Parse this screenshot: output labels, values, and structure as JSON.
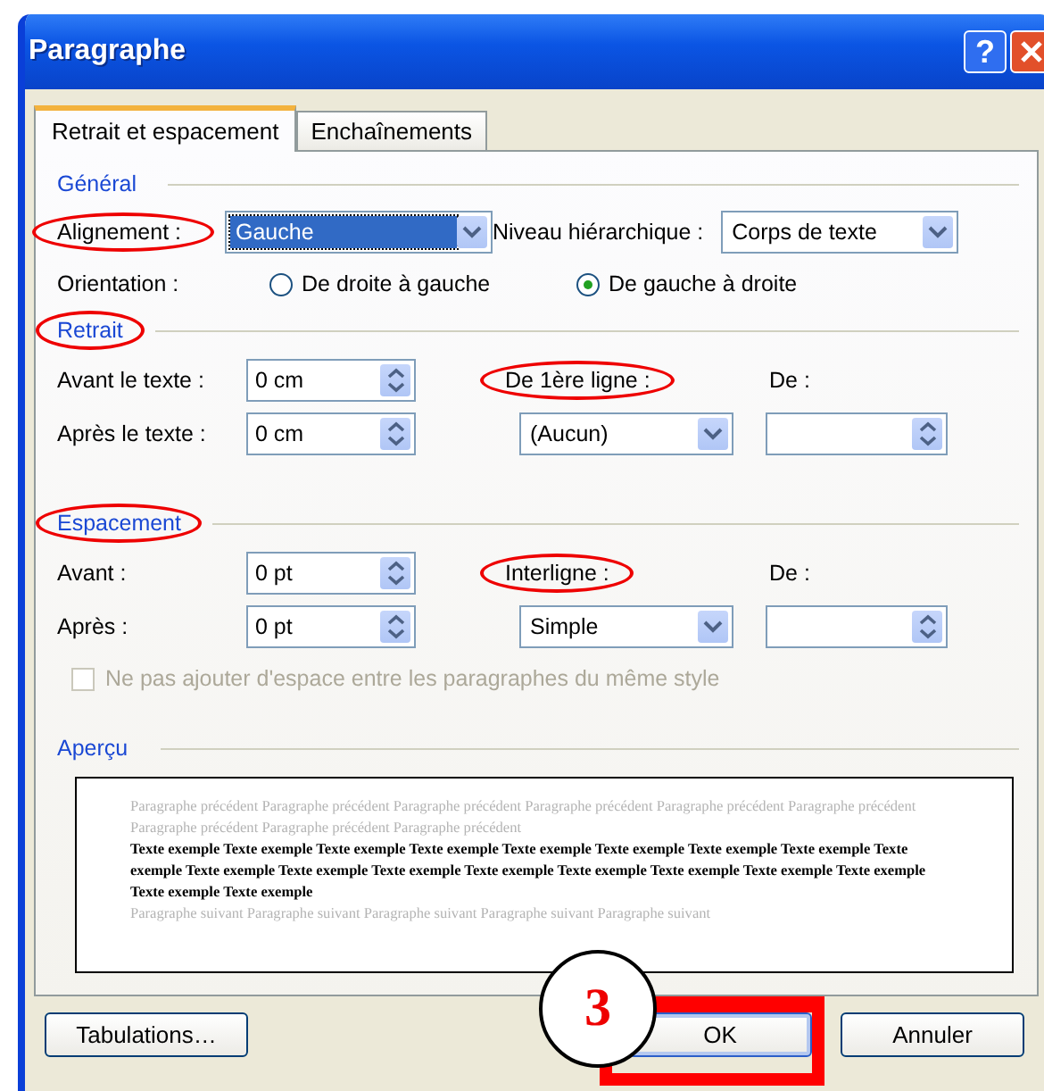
{
  "window": {
    "title": "Paragraphe",
    "help_button": "?"
  },
  "tabs": [
    {
      "label": "Retrait et espacement",
      "selected": true
    },
    {
      "label": "Enchaînements",
      "selected": false
    }
  ],
  "general": {
    "title": {
      "text": "Général",
      "circled": false
    },
    "alignment": {
      "label": {
        "text": "Alignement :",
        "circled": true
      },
      "value": "Gauche",
      "focused": true
    },
    "outline_level": {
      "label": {
        "text": "Niveau hiérarchique :",
        "circled": false
      },
      "value": "Corps de texte",
      "focused": false
    },
    "orientation": {
      "label": {
        "text": "Orientation :",
        "circled": false
      },
      "options": [
        {
          "label": "De droite à gauche",
          "selected": false
        },
        {
          "label": "De gauche à droite",
          "selected": true
        }
      ]
    }
  },
  "indentation": {
    "title": {
      "text": "Retrait",
      "circled": true
    },
    "before": {
      "label": {
        "text": "Avant le texte :",
        "circled": false
      },
      "value": "0 cm"
    },
    "after": {
      "label": {
        "text": "Après le texte :",
        "circled": false
      },
      "value": "0 cm"
    },
    "special": {
      "label": {
        "text": "De 1ère ligne :",
        "circled": true
      },
      "value": "(Aucun)"
    },
    "by": {
      "label": {
        "text": "De :",
        "circled": false
      }
    }
  },
  "spacing": {
    "title": {
      "text": "Espacement",
      "circled": true
    },
    "before": {
      "label": {
        "text": "Avant :",
        "circled": false
      },
      "value": "0 pt"
    },
    "after": {
      "label": {
        "text": "Après :",
        "circled": false
      },
      "value": "0 pt"
    },
    "line_spacing": {
      "label": {
        "text": "Interligne :",
        "circled": true
      },
      "value": "Simple"
    },
    "by": {
      "label": {
        "text": "De :",
        "circled": false
      }
    },
    "no_space_same_style": {
      "label": "Ne pas ajouter d'espace entre les paragraphes du même style",
      "checked": false,
      "disabled": true
    }
  },
  "preview": {
    "title": {
      "text": "Aperçu",
      "circled": false
    },
    "previous": "Paragraphe précédent Paragraphe précédent Paragraphe précédent Paragraphe précédent Paragraphe précédent Paragraphe précédent Paragraphe précédent Paragraphe précédent Paragraphe précédent",
    "sample": "Texte exemple Texte exemple Texte exemple Texte exemple Texte exemple Texte exemple Texte exemple Texte exemple Texte exemple Texte exemple Texte exemple Texte exemple Texte exemple Texte exemple Texte exemple Texte exemple Texte exemple Texte exemple Texte exemple",
    "next": "Paragraphe suivant Paragraphe suivant Paragraphe suivant Paragraphe suivant Paragraphe suivant"
  },
  "buttons": [
    {
      "label": "Tabulations…",
      "highlighted": false
    },
    {
      "label": "OK",
      "highlighted": true
    },
    {
      "label": "Annuler",
      "highlighted": false
    }
  ],
  "step_badge": "3"
}
